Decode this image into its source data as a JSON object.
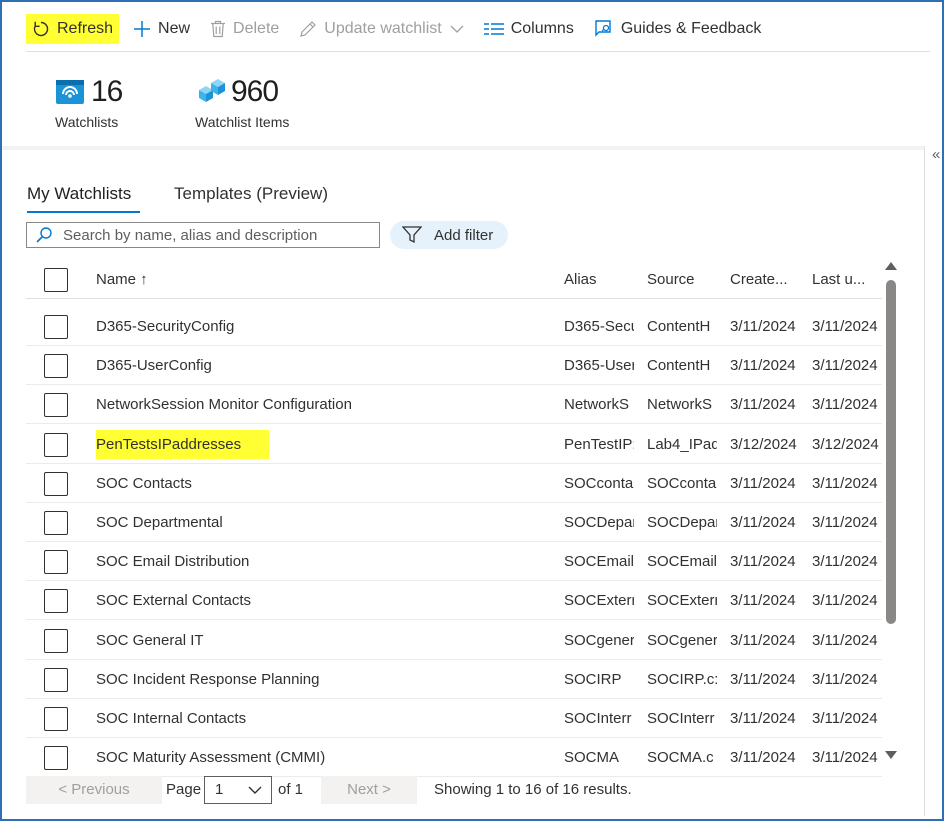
{
  "toolbar": {
    "refresh": "Refresh",
    "new": "New",
    "delete": "Delete",
    "update_watchlist": "Update watchlist",
    "columns": "Columns",
    "guides": "Guides & Feedback"
  },
  "stats": {
    "watchlists_count": "16",
    "watchlists_label": "Watchlists",
    "items_count": "960",
    "items_label": "Watchlist Items"
  },
  "collapse_glyph": "«",
  "tabs": {
    "my_watchlists": "My Watchlists",
    "templates": "Templates (Preview)"
  },
  "search": {
    "placeholder": "Search by name, alias and description"
  },
  "filter": {
    "label": "Add filter"
  },
  "table": {
    "columns": {
      "name": "Name ↑",
      "alias": "Alias",
      "source": "Source",
      "created": "Create...",
      "last_updated": "Last u..."
    },
    "rows": [
      {
        "name": "D365-SecurityConfig",
        "alias": "D365-Secu",
        "source": "ContentH",
        "created": "3/11/2024",
        "last_updated": "3/11/2024"
      },
      {
        "name": "D365-UserConfig",
        "alias": "D365-User",
        "source": "ContentH",
        "created": "3/11/2024",
        "last_updated": "3/11/2024"
      },
      {
        "name": "NetworkSession Monitor Configuration",
        "alias": "NetworkS",
        "source": "NetworkS",
        "created": "3/11/2024",
        "last_updated": "3/11/2024"
      },
      {
        "name": "PenTestsIPaddresses",
        "alias": "PenTestIP:",
        "source": "Lab4_IPad",
        "created": "3/12/2024",
        "last_updated": "3/12/2024",
        "highlight": true
      },
      {
        "name": "SOC Contacts",
        "alias": "SOCconta",
        "source": "SOCconta",
        "created": "3/11/2024",
        "last_updated": "3/11/2024"
      },
      {
        "name": "SOC Departmental",
        "alias": "SOCDepar",
        "source": "SOCDepar",
        "created": "3/11/2024",
        "last_updated": "3/11/2024"
      },
      {
        "name": "SOC Email Distribution",
        "alias": "SOCEmail",
        "source": "SOCEmail",
        "created": "3/11/2024",
        "last_updated": "3/11/2024"
      },
      {
        "name": "SOC External Contacts",
        "alias": "SOCExterr",
        "source": "SOCExterr",
        "created": "3/11/2024",
        "last_updated": "3/11/2024"
      },
      {
        "name": "SOC General IT",
        "alias": "SOCgener",
        "source": "SOCgener",
        "created": "3/11/2024",
        "last_updated": "3/11/2024"
      },
      {
        "name": "SOC Incident Response Planning",
        "alias": "SOCIRP",
        "source": "SOCIRP.c:",
        "created": "3/11/2024",
        "last_updated": "3/11/2024"
      },
      {
        "name": "SOC Internal Contacts",
        "alias": "SOCInterr",
        "source": "SOCInterr",
        "created": "3/11/2024",
        "last_updated": "3/11/2024"
      },
      {
        "name": "SOC Maturity Assessment (CMMI)",
        "alias": "SOCMA",
        "source": "SOCMA.c",
        "created": "3/11/2024",
        "last_updated": "3/11/2024"
      }
    ]
  },
  "pagination": {
    "previous": "< Previous",
    "page_label": "Page",
    "page_value": "1",
    "of": "of 1",
    "next": "Next >",
    "summary": "Showing 1 to 16 of 16 results."
  },
  "colors": {
    "accent": "#0078d4",
    "highlight": "#ffff33",
    "frame": "#2f6fb7"
  },
  "icons": [
    "refresh-icon",
    "plus-icon",
    "trash-icon",
    "pencil-icon",
    "chevron-down-icon",
    "columns-icon",
    "feedback-icon",
    "watchlist-icon",
    "cubes-icon",
    "search-icon",
    "filter-icon"
  ]
}
